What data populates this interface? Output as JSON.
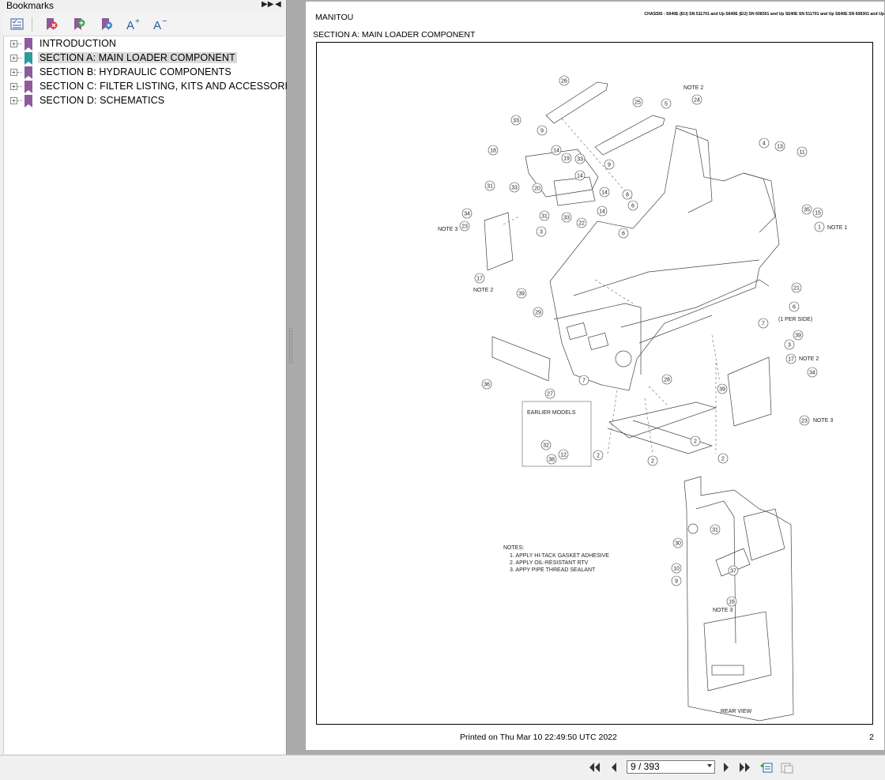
{
  "bookmarks_panel": {
    "title": "Bookmarks",
    "items": [
      {
        "label": "INTRODUCTION",
        "selected": false
      },
      {
        "label": "SECTION A: MAIN LOADER COMPONENT",
        "selected": true
      },
      {
        "label": "SECTION B: HYDRAULIC COMPONENTS",
        "selected": false
      },
      {
        "label": "SECTION C: FILTER LISTING, KITS AND ACCESSORIES",
        "selected": false
      },
      {
        "label": "SECTION D: SCHEMATICS",
        "selected": false
      }
    ],
    "toolbar_icons": [
      "bookmark-options-icon",
      "delete-bookmark-icon",
      "new-bookmark-icon",
      "expand-bookmark-icon",
      "text-larger-icon",
      "text-smaller-icon"
    ]
  },
  "page": {
    "header_left": "MANITOU",
    "header_right": "CHASSIS - S640E (EU) SN 511701 and Up S640E (EU) SN 608301 and Up S640E SN 511701 and Up S640E SN 608301 and Up",
    "section_title": "SECTION A: MAIN LOADER COMPONENT",
    "footer_printed": "Printed on   Thu Mar 10 22:49:50 UTC 2022",
    "footer_page": "2"
  },
  "drawing": {
    "notes_title": "NOTES:",
    "notes": [
      "1. APPLY HI-TACK GASKET ADHESIVE",
      "2. APPLY OIL-RESISTANT RTV",
      "3. APPY PIPE THREAD SEALANT"
    ],
    "earlier_models": "EARLIER MODELS",
    "rear_view": "REAR VIEW",
    "per_side": "(1 PER SIDE)",
    "note_labels": [
      "NOTE 2",
      "NOTE 3",
      "NOTE 2",
      "NOTE 2",
      "NOTE 3",
      "NOTE 1",
      "NOTE 3"
    ],
    "callouts": [
      "26",
      "25",
      "5",
      "24",
      "4",
      "13",
      "11",
      "33",
      "9",
      "14",
      "18",
      "19",
      "33",
      "9",
      "31",
      "33",
      "14",
      "20",
      "14",
      "31",
      "33",
      "22",
      "14",
      "8",
      "6",
      "3",
      "6",
      "34",
      "23",
      "17",
      "39",
      "35",
      "15",
      "1",
      "21",
      "6",
      "7",
      "39",
      "3",
      "29",
      "36",
      "27",
      "7",
      "28",
      "39",
      "17",
      "34",
      "23",
      "2",
      "2",
      "2",
      "2",
      "32",
      "12",
      "38",
      "31",
      "30",
      "10",
      "37",
      "9",
      "16"
    ]
  },
  "navbar": {
    "page_field": "9 / 393",
    "buttons": [
      "first-page-icon",
      "previous-page-icon",
      "next-page-icon",
      "last-page-icon",
      "previous-view-icon",
      "next-view-icon"
    ]
  }
}
